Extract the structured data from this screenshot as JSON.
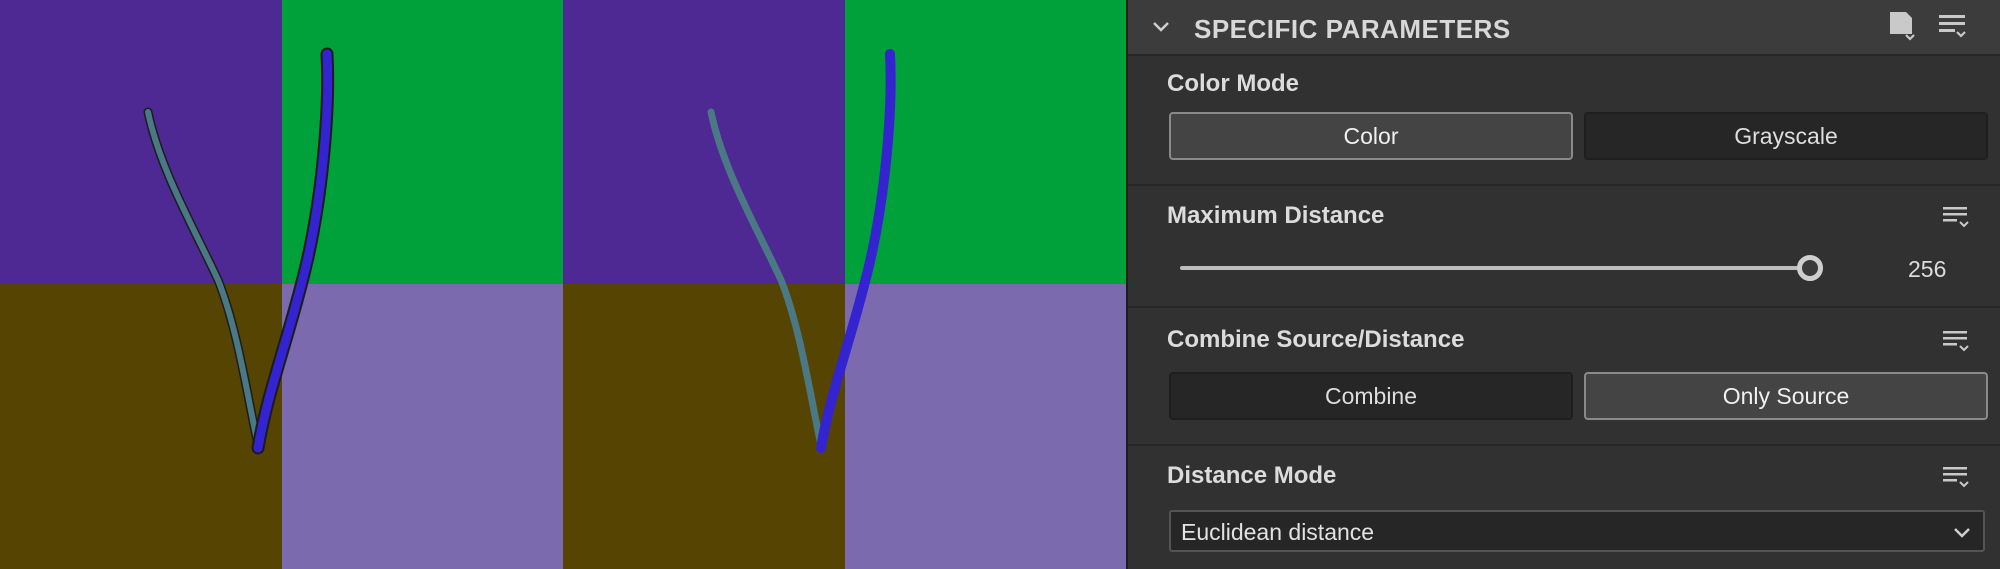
{
  "preview": {
    "colors": {
      "top_left": "#4e2893",
      "top_right": "#00a03b",
      "bottom_left": "#564402",
      "bottom_right": "#7b6aad",
      "stroke_teal": "#4a7885",
      "stroke_blue": "#3324cf"
    }
  },
  "panel": {
    "header": {
      "title": "SPECIFIC PARAMETERS",
      "collapse_icon": "chevron-down-icon",
      "preset_icon": "document-preset-icon",
      "menu_icon": "list-menu-icon"
    },
    "color_mode": {
      "label": "Color Mode",
      "options": [
        "Color",
        "Grayscale"
      ],
      "selected": "Color"
    },
    "maximum_distance": {
      "label": "Maximum Distance",
      "value": "256",
      "fraction": 1.0,
      "menu_icon": "list-menu-icon"
    },
    "combine": {
      "label": "Combine Source/Distance",
      "options": [
        "Combine",
        "Only Source"
      ],
      "selected": "Only Source",
      "menu_icon": "list-menu-icon"
    },
    "distance_mode": {
      "label": "Distance Mode",
      "value": "Euclidean distance",
      "menu_icon": "list-menu-icon"
    },
    "colors": {
      "panel_bg": "#313131",
      "header_bg": "#3c3c3c",
      "active_button_bg": "#444444",
      "inactive_button_bg": "#262626"
    }
  }
}
